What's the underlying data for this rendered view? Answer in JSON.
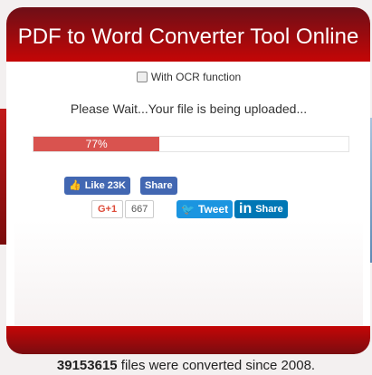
{
  "header": {
    "title": "PDF to Word Converter Tool Online"
  },
  "ocr": {
    "label": "With OCR function",
    "checked": false
  },
  "status": {
    "message": "Please Wait...Your file is being uploaded..."
  },
  "progress": {
    "percent": 77,
    "label": "77%"
  },
  "social": {
    "fb_like": "Like 23K",
    "fb_share": "Share",
    "gplus": "G+1",
    "gplus_count": "667",
    "tweet": "Tweet",
    "linkedin_icon": "in",
    "linkedin_share": "Share"
  },
  "footer": {
    "count": "39153615",
    "text": " files were converted since 2008."
  },
  "colors": {
    "accent": "#c40606",
    "progress": "#d9534f"
  }
}
